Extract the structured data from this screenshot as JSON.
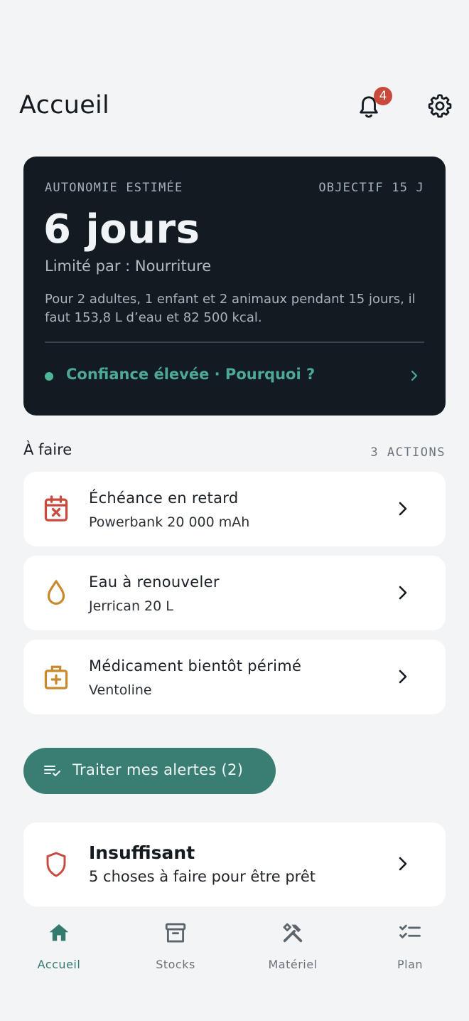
{
  "header": {
    "title": "Accueil",
    "notification_count": "4"
  },
  "hero": {
    "kicker": "AUTONOMIE ESTIMÉE",
    "goal": "OBJECTIF 15 J",
    "value": "6 jours",
    "limit": "Limité par : Nourriture",
    "description": "Pour 2 adultes, 1 enfant et 2 animaux pendant 15 jours, il faut 153,8 L d’eau et 82 500 kcal.",
    "confidence": "Confiance élevée · Pourquoi ?"
  },
  "todo": {
    "title": "À faire",
    "count": "3 ACTIONS",
    "items": [
      {
        "title": "Échéance en retard",
        "subtitle": "Powerbank 20 000 mAh",
        "icon": "calendar-x-icon"
      },
      {
        "title": "Eau à renouveler",
        "subtitle": "Jerrican 20 L",
        "icon": "water-drop-icon"
      },
      {
        "title": "Médicament bientôt périmé",
        "subtitle": "Ventoline",
        "icon": "medical-kit-icon"
      }
    ]
  },
  "alerts_button": {
    "label": "Traiter mes alertes (2)"
  },
  "readiness": {
    "title": "Insuffisant",
    "subtitle": "5 choses à faire pour être prêt"
  },
  "tabs": [
    {
      "label": "Accueil",
      "icon": "home-icon",
      "active": true
    },
    {
      "label": "Stocks",
      "icon": "archive-box-icon",
      "active": false
    },
    {
      "label": "Matériel",
      "icon": "tools-icon",
      "active": false
    },
    {
      "label": "Plan",
      "icon": "checklist-icon",
      "active": false
    }
  ],
  "colors": {
    "accent": "#3a7d72",
    "hero_bg": "#121a22",
    "danger": "#c94a3d",
    "warning": "#c98a2e",
    "background": "#f2f4f6"
  }
}
